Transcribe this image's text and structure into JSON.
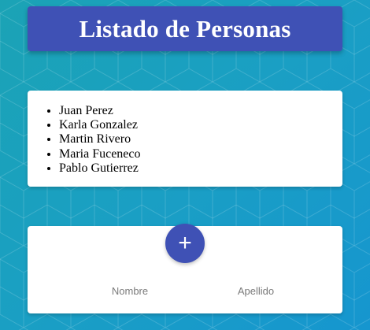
{
  "header": {
    "title": "Listado de Personas"
  },
  "persons": [
    "Juan Perez",
    "Karla Gonzalez",
    "Martin Rivero",
    "Maria Fuceneco",
    "Pablo Gutierrez"
  ],
  "form": {
    "add_label": "+",
    "nombre_placeholder": "Nombre",
    "apellido_placeholder": "Apellido",
    "nombre_value": "",
    "apellido_value": ""
  },
  "colors": {
    "primary": "#3f51b5",
    "background_start": "#1ba3b5",
    "background_end": "#1696cf",
    "card": "#ffffff"
  }
}
